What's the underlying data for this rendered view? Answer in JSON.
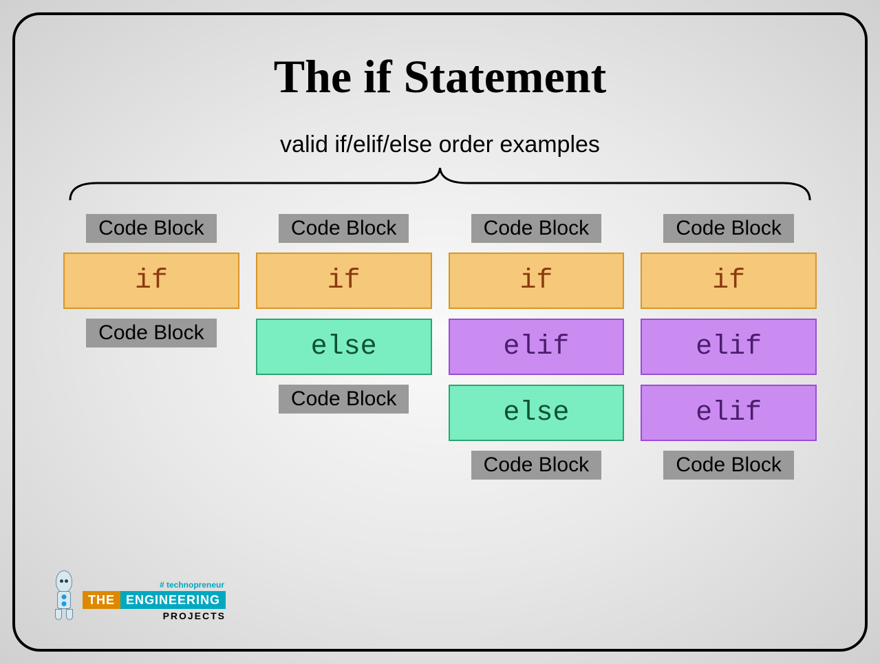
{
  "title": "The if Statement",
  "subtitle": "valid if/elif/else order examples",
  "code_block_label": "Code Block",
  "keywords": {
    "if": "if",
    "elif": "elif",
    "else": "else"
  },
  "columns": [
    {
      "blocks": [
        "codeblock",
        "if",
        "codeblock"
      ]
    },
    {
      "blocks": [
        "codeblock",
        "if",
        "else",
        "codeblock"
      ]
    },
    {
      "blocks": [
        "codeblock",
        "if",
        "elif",
        "else",
        "codeblock"
      ]
    },
    {
      "blocks": [
        "codeblock",
        "if",
        "elif",
        "elif",
        "codeblock"
      ]
    }
  ],
  "logo": {
    "hashtag": "# technopreneur",
    "the": "THE",
    "eng": "ENGINEERING",
    "proj": "PROJECTS"
  }
}
